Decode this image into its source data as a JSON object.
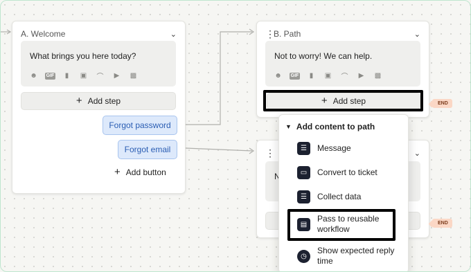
{
  "cards": {
    "welcome": {
      "title": "A. Welcome",
      "message": "What brings you here today?",
      "add_step": "Add step",
      "buttons": [
        "Forgot password",
        "Forgot email"
      ],
      "add_button": "Add button"
    },
    "path": {
      "title": "B. Path",
      "message": "Not to worry! We can help.",
      "add_step": "Add step"
    },
    "hidden": {
      "message_partial": "N"
    }
  },
  "toolbar_icons": [
    "emoji-icon",
    "gif-icon",
    "book-icon",
    "image-icon",
    "attachment-icon",
    "video-icon",
    "app-icon"
  ],
  "toolbar_gif": "GIF",
  "end_label": "END",
  "dropdown": {
    "title": "Add content to path",
    "items": [
      {
        "label": "Message",
        "icon": "message-icon"
      },
      {
        "label": "Convert to ticket",
        "icon": "ticket-icon"
      },
      {
        "label": "Collect data",
        "icon": "collect-data-icon"
      },
      {
        "label": "Pass to reusable workflow",
        "icon": "workflow-icon"
      },
      {
        "label": "Show expected reply time",
        "icon": "clock-icon"
      }
    ]
  },
  "colors": {
    "chip_bg": "#dde9fb",
    "chip_text": "#2a5db3",
    "end_tag_bg": "#fbd7c5",
    "highlight": "#000000"
  }
}
